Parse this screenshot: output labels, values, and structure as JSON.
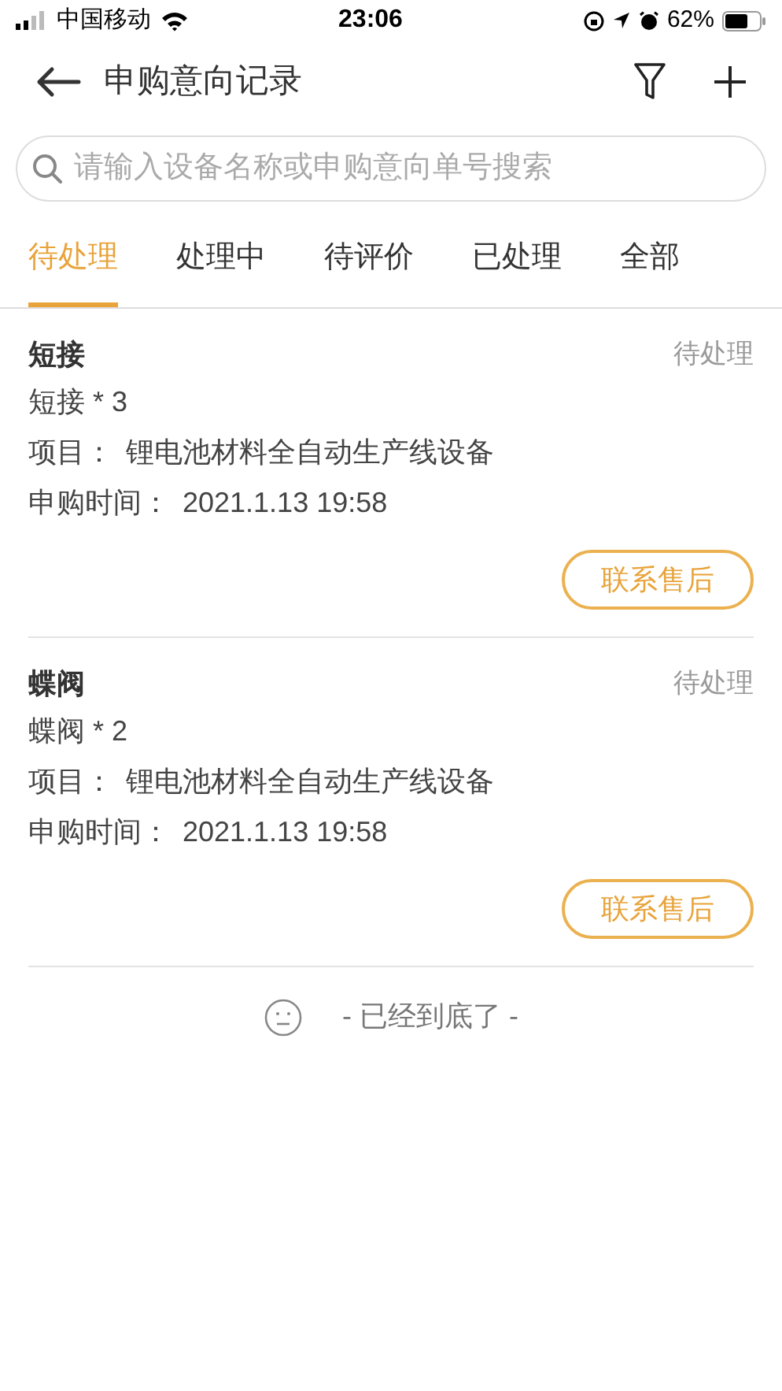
{
  "status_bar": {
    "carrier": "中国移动",
    "time": "23:06",
    "battery": "62%"
  },
  "header": {
    "title": "申购意向记录"
  },
  "search": {
    "placeholder": "请输入设备名称或申购意向单号搜索"
  },
  "tabs": [
    {
      "label": "待处理",
      "selected": true
    },
    {
      "label": "处理中",
      "selected": false
    },
    {
      "label": "待评价",
      "selected": false
    },
    {
      "label": "已处理",
      "selected": false
    },
    {
      "label": "全部",
      "selected": false
    }
  ],
  "records": [
    {
      "name": "短接",
      "status": "待处理",
      "quantity": "短接 * 3",
      "project_label": "项目：",
      "project": "锂电池材料全自动生产线设备",
      "time_label": "申购时间：",
      "time": "2021.1.13 19:58",
      "action": "联系售后"
    },
    {
      "name": "蝶阀",
      "status": "待处理",
      "quantity": "蝶阀 * 2",
      "project_label": "项目：",
      "project": "锂电池材料全自动生产线设备",
      "time_label": "申购时间：",
      "time": "2021.1.13 19:58",
      "action": "联系售后"
    }
  ],
  "footer": {
    "end_text": "- 已经到底了 -"
  }
}
